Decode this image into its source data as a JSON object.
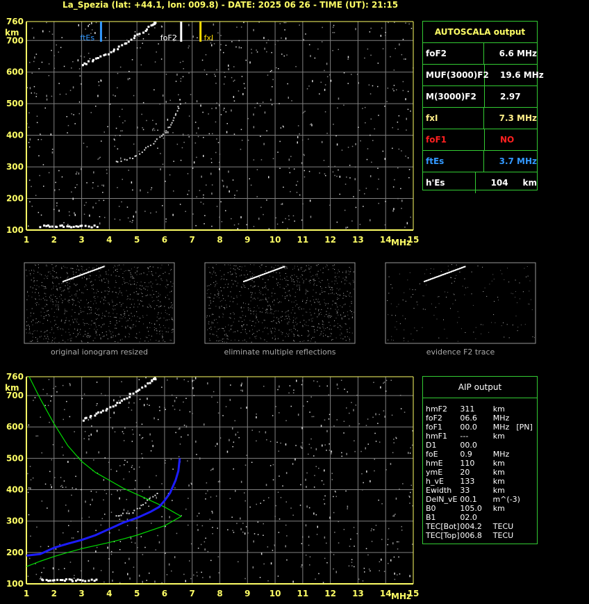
{
  "header": {
    "title": "La_Spezia (lat: +44.1, lon: 009.8) - DATE: 2025 06 26 - TIME (UT): 21:15"
  },
  "colors": {
    "axis": "#ffff66",
    "grid": "#808080",
    "panel_border": "#33cc33",
    "ftEs": "#3399ff",
    "foF2": "#ffffff",
    "fxI": "#ffdd00",
    "profile_fit": "#00dd00",
    "profile_trace": "#1c1cff",
    "foF1_red": "#ff2020"
  },
  "top_ionogram": {
    "unit_y": "km",
    "unit_x": "MHz",
    "markers": [
      {
        "label": "ftEs",
        "freq": 3.7,
        "color": "#3399ff"
      },
      {
        "label": "foF2",
        "freq": 6.6,
        "color": "#ffffff"
      },
      {
        "label": "fxI",
        "freq": 7.3,
        "color": "#ffdd00"
      }
    ]
  },
  "thumbnails": [
    {
      "caption": "original ionogram resized"
    },
    {
      "caption": "eliminate multiple reflections"
    },
    {
      "caption": "evidence F2 trace"
    }
  ],
  "autoscala": {
    "title": "AUTOSCALA output",
    "rows": [
      {
        "key": "foF2",
        "value": "6.6 MHz",
        "key_color": "#ffffff",
        "val_color": "#ffffff"
      },
      {
        "key": "MUF(3000)F2",
        "value": "19.6 MHz",
        "key_color": "#ffffff",
        "val_color": "#ffffff"
      },
      {
        "key": "M(3000)F2",
        "value": "2.97",
        "key_color": "#ffffff",
        "val_color": "#ffffff"
      },
      {
        "key": "fxI",
        "value": "7.3 MHz",
        "key_color": "#ffee88",
        "val_color": "#ffee88"
      },
      {
        "key": "foF1",
        "value": "NO",
        "key_color": "#ff2020",
        "val_color": "#ff2020"
      },
      {
        "key": "ftEs",
        "value": "3.7 MHz",
        "key_color": "#3399ff",
        "val_color": "#3399ff"
      },
      {
        "key": "h'Es",
        "value": "104     km",
        "key_color": "#ffffff",
        "val_color": "#ffffff"
      }
    ]
  },
  "aip": {
    "title": "AIP output",
    "rows": [
      [
        "hmF2",
        "311",
        "km",
        ""
      ],
      [
        "foF2",
        "06.6",
        "MHz",
        ""
      ],
      [
        "foF1",
        "00.0",
        "MHz",
        "[PN]"
      ],
      [
        "hmF1",
        "---",
        "km",
        ""
      ],
      [
        "D1",
        "00.0",
        "",
        ""
      ],
      [
        "foE",
        "0.9",
        "MHz",
        ""
      ],
      [
        "hmE",
        "110",
        "km",
        ""
      ],
      [
        "ymE",
        "20",
        "km",
        ""
      ],
      [
        "h_vE",
        "133",
        "km",
        ""
      ],
      [
        "Ewidth",
        "33",
        "km",
        ""
      ],
      [
        "DelN_vE",
        "00.1",
        "m^(-3)",
        ""
      ],
      [
        "B0",
        "105.0",
        "km",
        ""
      ],
      [
        "B1",
        "02.0",
        "",
        ""
      ],
      [
        "TEC[Bot]",
        "004.2",
        "TECU",
        ""
      ],
      [
        "TEC[Top]",
        "006.8",
        "TECU",
        ""
      ]
    ]
  },
  "chart_data": [
    {
      "type": "scatter",
      "title": "",
      "xlabel": "MHz",
      "ylabel": "km",
      "xlim": [
        1,
        15
      ],
      "ylim": [
        100,
        760
      ],
      "xticks": [
        1,
        2,
        3,
        4,
        5,
        6,
        7,
        8,
        9,
        10,
        11,
        12,
        13,
        14,
        15
      ],
      "yticks": [
        100,
        200,
        300,
        400,
        500,
        600,
        700,
        760
      ],
      "grid": true,
      "series": [
        {
          "name": "",
          "points": [
            [
              3.0,
              625
            ],
            [
              3.5,
              645
            ],
            [
              4.0,
              665
            ],
            [
              4.5,
              690
            ],
            [
              5.0,
              720
            ],
            [
              5.5,
              750
            ],
            [
              5.7,
              760
            ]
          ]
        },
        {
          "name": "",
          "points": [
            [
              4.2,
              318
            ],
            [
              4.8,
              330
            ],
            [
              5.3,
              360
            ],
            [
              5.8,
              395
            ],
            [
              6.2,
              430
            ],
            [
              6.4,
              470
            ],
            [
              6.6,
              520
            ]
          ]
        },
        {
          "name": "",
          "points": [
            [
              1.5,
              115
            ],
            [
              2.0,
              115
            ],
            [
              2.5,
              115
            ],
            [
              3.0,
              115
            ],
            [
              3.6,
              115
            ]
          ]
        }
      ]
    },
    {
      "type": "line",
      "title": "",
      "xlabel": "MHz",
      "ylabel": "km",
      "xlim": [
        1,
        15
      ],
      "ylim": [
        100,
        760
      ],
      "xticks": [
        1,
        2,
        3,
        4,
        5,
        6,
        7,
        8,
        9,
        10,
        11,
        12,
        13,
        14,
        15
      ],
      "yticks": [
        100,
        200,
        300,
        400,
        500,
        600,
        700,
        760
      ],
      "grid": true,
      "series": [
        {
          "name": "",
          "points": [
            [
              1.0,
              190
            ],
            [
              1.5,
              195
            ],
            [
              2.0,
              215
            ],
            [
              2.5,
              228
            ],
            [
              3.0,
              240
            ],
            [
              3.5,
              255
            ],
            [
              4.0,
              275
            ],
            [
              4.5,
              295
            ],
            [
              5.0,
              310
            ],
            [
              5.5,
              330
            ],
            [
              5.8,
              345
            ],
            [
              6.0,
              365
            ],
            [
              6.2,
              390
            ],
            [
              6.4,
              430
            ],
            [
              6.5,
              460
            ],
            [
              6.55,
              500
            ]
          ]
        },
        {
          "name": "",
          "points": [
            [
              1.1,
              760
            ],
            [
              1.5,
              690
            ],
            [
              2.0,
              610
            ],
            [
              2.5,
              540
            ],
            [
              3.0,
              490
            ],
            [
              3.5,
              455
            ],
            [
              4.0,
              430
            ],
            [
              4.5,
              405
            ],
            [
              5.0,
              385
            ],
            [
              5.5,
              365
            ],
            [
              6.0,
              345
            ],
            [
              6.3,
              330
            ],
            [
              6.6,
              315
            ],
            [
              6.3,
              300
            ],
            [
              6.0,
              285
            ],
            [
              5.5,
              270
            ],
            [
              5.0,
              255
            ],
            [
              4.5,
              243
            ],
            [
              4.0,
              232
            ],
            [
              3.5,
              222
            ],
            [
              3.0,
              212
            ],
            [
              2.5,
              200
            ],
            [
              2.0,
              187
            ],
            [
              1.5,
              172
            ],
            [
              1.0,
              155
            ]
          ]
        },
        {
          "name": "",
          "points": [
            [
              3.0,
              625
            ],
            [
              3.5,
              645
            ],
            [
              4.0,
              665
            ],
            [
              4.5,
              690
            ],
            [
              5.0,
              720
            ],
            [
              5.5,
              750
            ],
            [
              5.7,
              760
            ]
          ]
        },
        {
          "name": "",
          "points": [
            [
              4.2,
              318
            ],
            [
              4.8,
              330
            ],
            [
              5.3,
              360
            ],
            [
              5.8,
              395
            ]
          ]
        },
        {
          "name": "",
          "points": [
            [
              1.5,
              115
            ],
            [
              2.0,
              115
            ],
            [
              2.5,
              115
            ],
            [
              3.0,
              115
            ],
            [
              3.6,
              115
            ]
          ]
        }
      ]
    }
  ]
}
